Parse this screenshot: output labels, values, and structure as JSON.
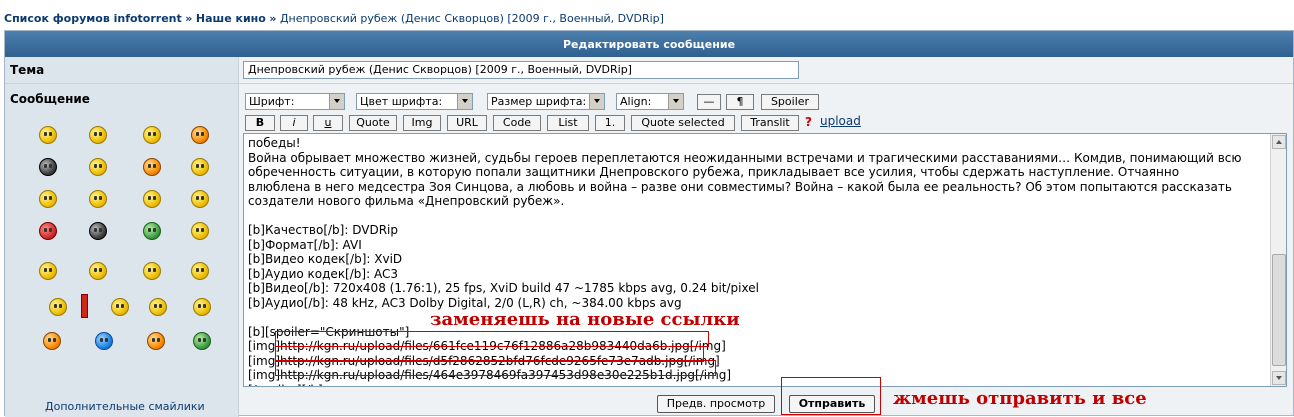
{
  "breadcrumb": {
    "forum_list": "Список форумов infotorrent",
    "sep": "»",
    "section": "Наше кино",
    "topic": "Днепровский рубеж (Денис Скворцов) [2009 г., Военный, DVDRip]"
  },
  "header": {
    "title": "Редактировать сообщение"
  },
  "form": {
    "topic_label": "Тема",
    "topic_value": "Днепровский рубеж (Денис Скворцов) [2009 г., Военный, DVDRip]",
    "message_label": "Сообщение"
  },
  "smilies": {
    "more_label": "Дополнительные смайлики"
  },
  "toolbar": {
    "font": "Шрифт:",
    "font_color": "Цвет шрифта:",
    "font_size": "Размер шрифта:",
    "align": "Align:",
    "hr": "—",
    "para": "¶",
    "spoiler": "Spoiler",
    "bold": "B",
    "italic": "i",
    "underline": "u",
    "quote": "Quote",
    "img": "Img",
    "url": "URL",
    "code": "Code",
    "list": "List",
    "list_num": "1.",
    "quote_selected": "Quote selected",
    "translit": "Translit",
    "help": "?",
    "upload": "upload"
  },
  "message": {
    "text": "победы!\nВойна обрывает множество жизней, судьбы героев переплетаются неожиданными встречами и трагическими расставаниями… Комдив, понимающий всю\nобреченность ситуации, в которую попали защитники Днепровского рубежа, прикладывает все усилия, чтобы сдержать наступление. Отчаянно\nвлюблена в него медсестра Зоя Синцова, а любовь и война – разве они совместимы? Война – какой была ее реальность? Об этом попытаются рассказать\nсоздатели нового фильма «Днепровский рубеж».\n\n[b]Качество[/b]: DVDRip\n[b]Формат[/b]: AVI\n[b]Видео кодек[/b]: XviD\n[b]Аудио кодек[/b]: AC3\n[b]Видео[/b]: 720x408 (1.76:1), 25 fps, XviD build 47 ~1785 kbps avg, 0.24 bit/pixel\n[b]Аудио[/b]: 48 kHz, AC3 Dolby Digital, 2/0 (L,R) ch, ~384.00 kbps avg\n\n[b][spoiler=\"Скриншоты\"]\n[img]http://kgn.ru/upload/files/661fce119c76f12886a28b983440da6b.jpg[/img]\n[img]http://kgn.ru/upload/files/d5f2862852bfd76fcde9265fe73e7adb.jpg[/img]\n[img]http://kgn.ru/upload/files/464e3978469fa397453d98e30e225b1d.jpg[/img]\n[/spoiler][/b]"
  },
  "annotations": {
    "replace_links": "заменяешь на новые ссылки",
    "press_send": "жмешь отправить и все",
    "color": "#c00000"
  },
  "buttons": {
    "preview": "Предв. просмотр",
    "submit": "Отправить"
  }
}
